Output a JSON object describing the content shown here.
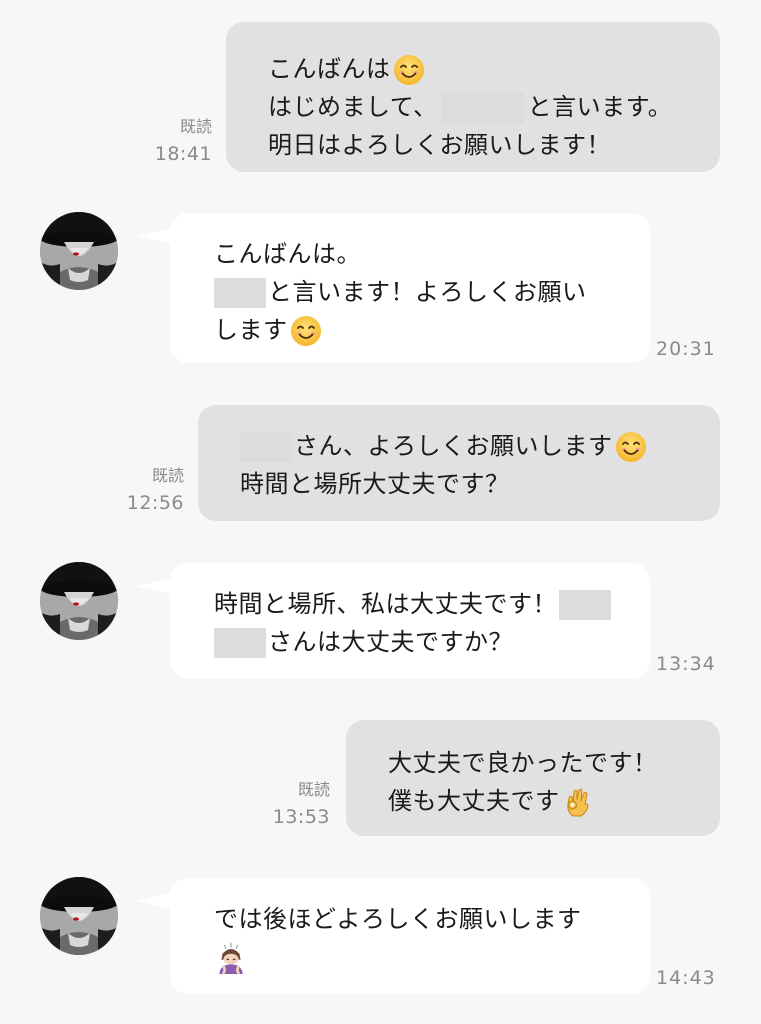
{
  "messages": [
    {
      "direction": "sent",
      "read_label": "既読",
      "time": "18:41",
      "lines": [
        "こんばんは",
        "はじめまして、",
        "と言います。",
        "明日はよろしくお願いします！"
      ]
    },
    {
      "direction": "received",
      "time": "20:31",
      "lines": [
        "こんばんは。",
        "と言います！よろしくお願い",
        "します"
      ]
    },
    {
      "direction": "sent",
      "read_label": "既読",
      "time": "12:56",
      "lines": [
        "さん、よろしくお願いします",
        "時間と場所大丈夫です？"
      ]
    },
    {
      "direction": "received",
      "time": "13:34",
      "lines": [
        "時間と場所、私は大丈夫です！",
        "さんは大丈夫ですか？"
      ]
    },
    {
      "direction": "sent",
      "read_label": "既読",
      "time": "13:53",
      "lines": [
        "大丈夫で良かったです！",
        "僕も大丈夫です"
      ]
    },
    {
      "direction": "received",
      "time": "14:43",
      "lines": [
        "では後ほどよろしくお願いします"
      ]
    }
  ],
  "emoji_icons": [
    "smiling-face-icon",
    "ok-hand-icon",
    "person-bowing-icon"
  ],
  "colors": {
    "background": "#f7f7f7",
    "sent_bubble": "#e1e1e1",
    "received_bubble": "#ffffff",
    "meta_text": "#8a8a8a",
    "redaction": "#dcdcdc"
  }
}
